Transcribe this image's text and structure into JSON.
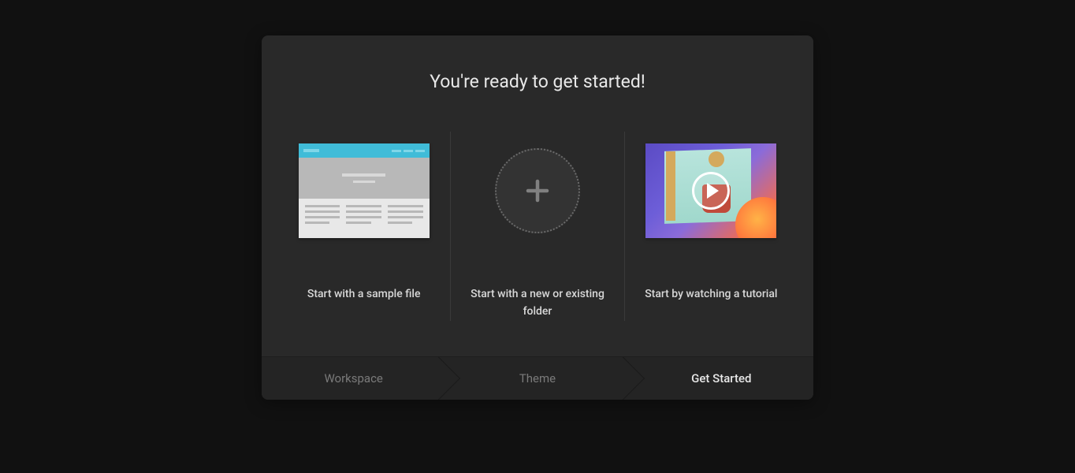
{
  "dialog": {
    "title": "You're ready to get started!"
  },
  "options": {
    "sample_file": "Start with a sample file",
    "new_folder": "Start with a new or existing folder",
    "tutorial": "Start by watching a tutorial"
  },
  "stepper": {
    "workspace": "Workspace",
    "theme": "Theme",
    "get_started": "Get Started"
  }
}
